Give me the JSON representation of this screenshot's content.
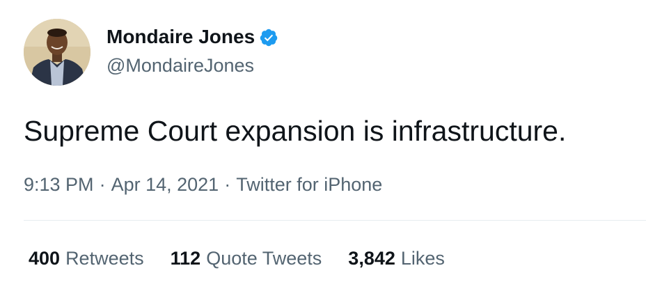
{
  "author": {
    "display_name": "Mondaire Jones",
    "handle": "@MondaireJones",
    "verified": true,
    "verified_color": "#1d9bf0"
  },
  "tweet": {
    "text": "Supreme Court expansion is infrastructure.",
    "time": "9:13 PM",
    "date": "Apr 14, 2021",
    "source": "Twitter for iPhone",
    "separator": "·"
  },
  "stats": [
    {
      "count": "400",
      "label": "Retweets"
    },
    {
      "count": "112",
      "label": "Quote Tweets"
    },
    {
      "count": "3,842",
      "label": "Likes"
    }
  ],
  "colors": {
    "text": "#0f1419",
    "secondary": "#536471",
    "divider": "#e6ecf0"
  }
}
